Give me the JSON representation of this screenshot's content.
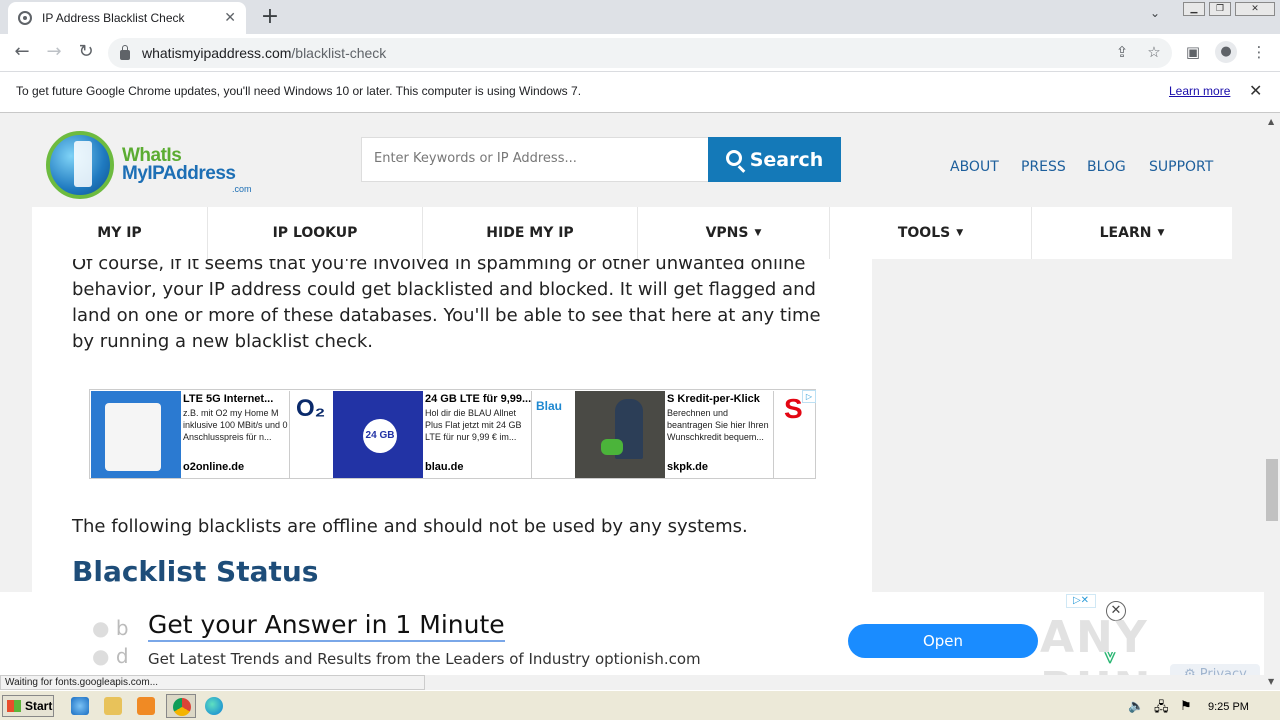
{
  "browser": {
    "tab_title": "IP Address Blacklist Check",
    "tab_close": "✕",
    "new_tab": "+",
    "url_domain": "whatismyipaddress.com",
    "url_path": "/blacklist-check",
    "window_buttons": [
      "▭",
      "◰",
      "✕"
    ]
  },
  "infobar": {
    "message": "To get future Google Chrome updates, you'll need Windows 10 or later. This computer is using Windows 7.",
    "link": "Learn more",
    "close": "✕"
  },
  "site": {
    "logo_line1": "WhatIs",
    "logo_line2": "MyIPAddress",
    "logo_suffix": ".com",
    "search_placeholder": "Enter Keywords or IP Address...",
    "search_button": "Search",
    "top_links": [
      "ABOUT",
      "PRESS",
      "BLOG",
      "SUPPORT"
    ],
    "menu": [
      {
        "label": "MY IP",
        "dropdown": false
      },
      {
        "label": "IP LOOKUP",
        "dropdown": false
      },
      {
        "label": "HIDE MY IP",
        "dropdown": false
      },
      {
        "label": "VPNS",
        "dropdown": true
      },
      {
        "label": "TOOLS",
        "dropdown": true
      },
      {
        "label": "LEARN",
        "dropdown": true
      }
    ],
    "dropdown_arrow": "▼"
  },
  "content": {
    "paragraph": "Of course, if it seems that you're involved in spamming or other unwanted online behavior, your IP address could get blacklisted and blocked. It will get flagged and land on one or more of these databases. You'll be able to see that here at any time by running a new blacklist check.",
    "offline_note": "The following blacklists are offline and should not be used by any systems.",
    "heading": "Blacklist Status",
    "behind_items": [
      "bl",
      "di"
    ]
  },
  "ads": [
    {
      "title": "LTE 5G Internet...",
      "desc": "z.B. mit O2 my Home M inklusive 100 MBit/s und 0 Anschlusspreis für n...",
      "domain": "o2online.de",
      "brand": "O₂",
      "brand_color": "#0a2a6b"
    },
    {
      "title": "24 GB LTE für 9,99...",
      "desc": "Hol dir die BLAU Allnet Plus Flat jetzt mit 24 GB LTE für nur 9,99 € im...",
      "domain": "blau.de",
      "brand": "Blau",
      "brand_color": "#1e88d0",
      "img_text": "24 GB"
    },
    {
      "title": "S Kredit-per-Klick",
      "desc": "Berechnen und beantragen Sie hier Ihren Wunschkredit bequem...",
      "domain": "skpk.de",
      "brand": "S",
      "brand_color": "#e30613"
    }
  ],
  "bottom_ad": {
    "headline": "Get your Answer in 1 Minute",
    "subline": "Get Latest Trends and Results from the Leaders of Industry optionish.com",
    "button": "Open",
    "adchoice": "▷✕",
    "close": "✕",
    "privacy": "Privacy",
    "watermark": "ANY RUN"
  },
  "status_text": "Waiting for fonts.googleapis.com...",
  "taskbar": {
    "start": "Start",
    "clock": "9:25 PM"
  },
  "colors": {
    "brand_blue": "#1479b8",
    "heading_blue": "#1e4d79",
    "link_blue": "#1d5f9c"
  }
}
